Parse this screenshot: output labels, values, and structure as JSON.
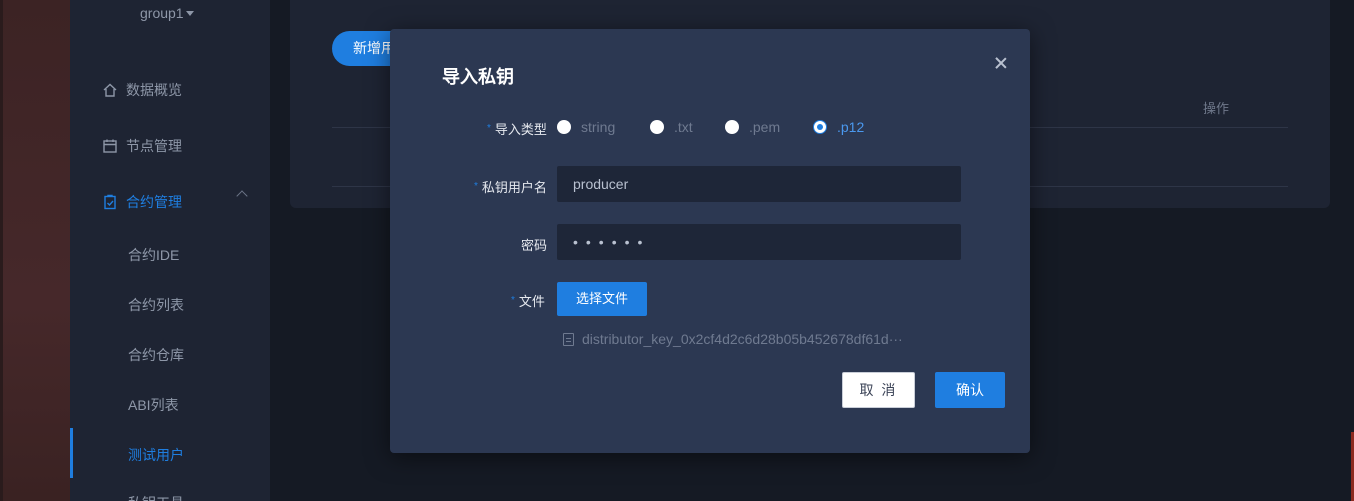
{
  "sidebar": {
    "group": "group1",
    "items": [
      {
        "label": "数据概览",
        "icon": "home-icon"
      },
      {
        "label": "节点管理",
        "icon": "calendar-icon"
      },
      {
        "label": "合约管理",
        "icon": "clipboard-icon"
      }
    ],
    "sub_items": [
      "合约IDE",
      "合约列表",
      "合约仓库",
      "ABI列表",
      "测试用户",
      "私钥工具"
    ]
  },
  "content": {
    "new_button": "新增用户",
    "ops_header": "操作"
  },
  "modal": {
    "title": "导入私钥",
    "type_label": "导入类型",
    "type_options": [
      "string",
      ".txt",
      ".pem",
      ".p12"
    ],
    "type_selected": ".p12",
    "username_label": "私钥用户名",
    "username_value": "producer",
    "password_label": "密码",
    "password_value": "••••••",
    "file_label": "文件",
    "choose_file_button": "选择文件",
    "file_name": "distributor_key_0x2cf4d2c6d28b05b452678df61d···",
    "cancel_button": "取 消",
    "confirm_button": "确认"
  },
  "colors": {
    "accent": "#1f7ee0",
    "modal_bg": "#2c3852",
    "sidebar_bg": "#1e2433",
    "page_bg": "#151a24"
  }
}
